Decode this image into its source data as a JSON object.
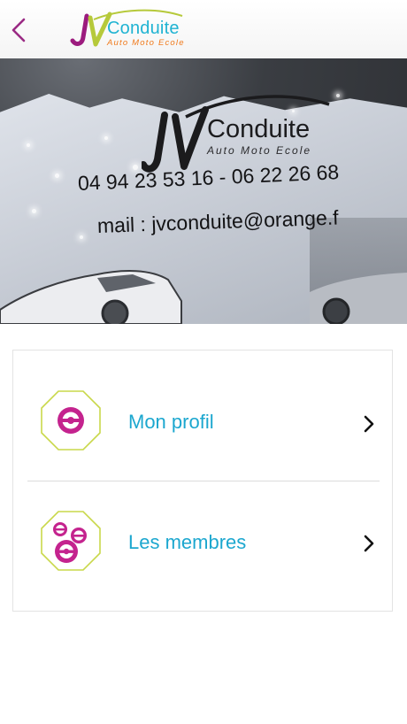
{
  "header": {
    "back_icon": "chevron-left-icon",
    "logo_mark": "JV",
    "logo_text": "Conduite",
    "logo_subtitle": "Auto Moto Ecole",
    "colors": {
      "back": "#9a2a84",
      "brand_j": "#9c1b7e",
      "brand_v": "#b6c93a",
      "brand_text": "#1fb3d2",
      "subtitle": "#f07a1c"
    }
  },
  "hero": {
    "brand": "Conduite",
    "brand_subtitle": "Auto Moto Ecole",
    "phone": "04 94 23 53 16 - 06 22 26 68",
    "mail": "mail : jvconduite@orange.f"
  },
  "menu": {
    "items": [
      {
        "label": "Mon profil",
        "icon": "steering-wheel-icon",
        "chevron": "chevron-right-icon"
      },
      {
        "label": "Les membres",
        "icon": "steering-wheels-group-icon",
        "chevron": "chevron-right-icon"
      }
    ],
    "colors": {
      "label": "#1ca7cf",
      "icon_fill": "#c4238e",
      "octagon_border": "#c9d84a"
    }
  }
}
